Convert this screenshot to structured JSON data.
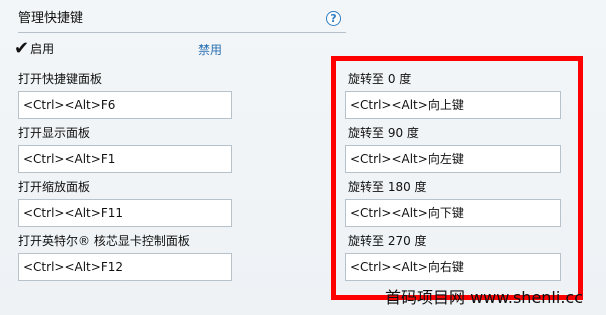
{
  "header": {
    "title": "管理快捷键",
    "help_label": "?"
  },
  "toggle": {
    "enable_label": "启用",
    "disable_label": "禁用"
  },
  "left_items": [
    {
      "label": "打开快捷键面板",
      "value": "<Ctrl><Alt>F6"
    },
    {
      "label": "打开显示面板",
      "value": "<Ctrl><Alt>F1"
    },
    {
      "label": "打开缩放面板",
      "value": "<Ctrl><Alt>F11"
    },
    {
      "label": "打开英特尔® 核芯显卡控制面板",
      "value": "<Ctrl><Alt>F12"
    }
  ],
  "right_items": [
    {
      "label": "旋转至 0 度",
      "value": "<Ctrl><Alt>向上键"
    },
    {
      "label": "旋转至 90 度",
      "value": "<Ctrl><Alt>向左键"
    },
    {
      "label": "旋转至 180 度",
      "value": "<Ctrl><Alt>向下键"
    },
    {
      "label": "旋转至 270 度",
      "value": "<Ctrl><Alt>向右键"
    }
  ],
  "watermark": "首码项目网 www.shenli.cc",
  "colors": {
    "accent": "#2f7dc1",
    "highlight": "#ff0000"
  }
}
